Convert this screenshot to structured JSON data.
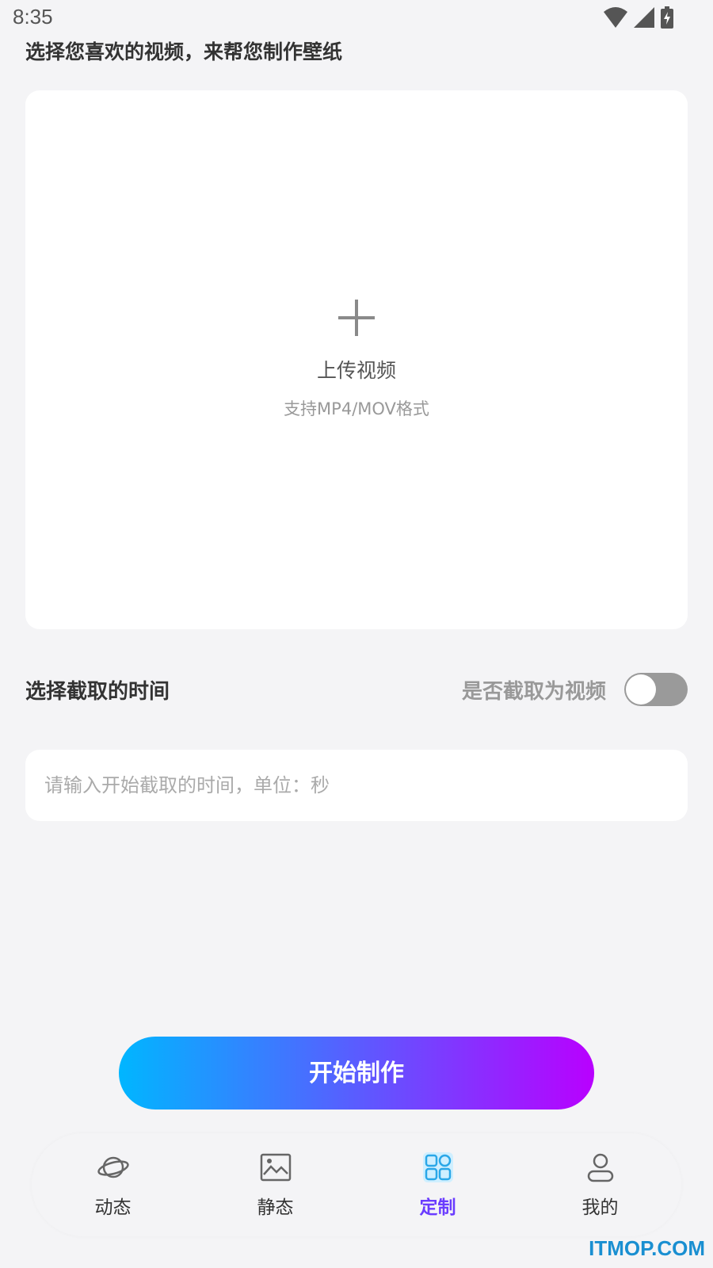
{
  "status_bar": {
    "time": "8:35"
  },
  "page": {
    "title": "选择您喜欢的视频，来帮您制作壁纸"
  },
  "upload": {
    "label": "上传视频",
    "hint": "支持MP4/MOV格式",
    "icon": "plus-icon"
  },
  "time_section": {
    "title": "选择截取的时间",
    "toggle_label": "是否截取为视频",
    "toggle_on": false,
    "input_placeholder": "请输入开始截取的时间，单位：秒",
    "input_value": ""
  },
  "start_button": {
    "label": "开始制作"
  },
  "bottom_nav": {
    "items": [
      {
        "label": "动态",
        "icon": "planet-icon",
        "active": false
      },
      {
        "label": "静态",
        "icon": "image-icon",
        "active": false
      },
      {
        "label": "定制",
        "icon": "grid-icon",
        "active": true
      },
      {
        "label": "我的",
        "icon": "user-icon",
        "active": false
      }
    ]
  },
  "watermark": "ITMOP.COM",
  "colors": {
    "accent": "#6a3cff",
    "gradient_start": "#00b6ff",
    "gradient_end": "#b900ff",
    "background": "#f4f4f6"
  }
}
